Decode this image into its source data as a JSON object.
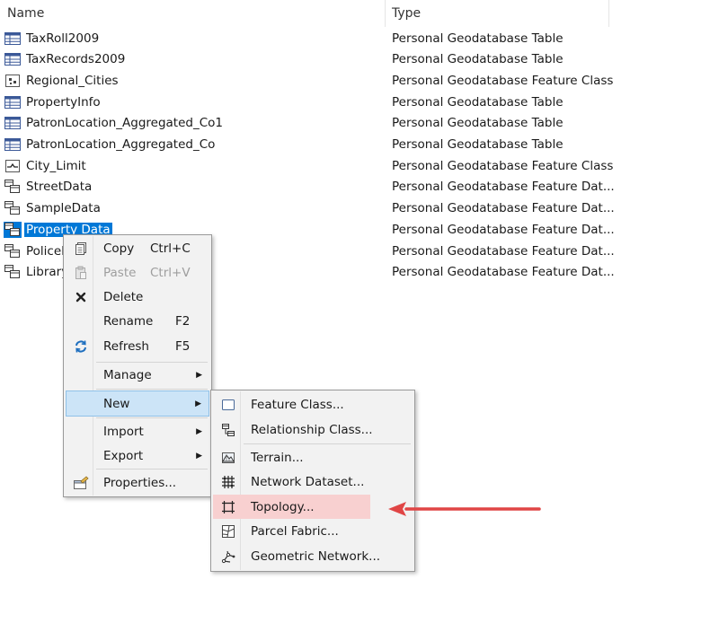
{
  "columns": {
    "name": "Name",
    "type": "Type"
  },
  "rows": [
    {
      "name": "TaxRoll2009",
      "type": "Personal Geodatabase Table",
      "icon": "table-icon"
    },
    {
      "name": "TaxRecords2009",
      "type": "Personal Geodatabase Table",
      "icon": "table-icon"
    },
    {
      "name": "Regional_Cities",
      "type": "Personal Geodatabase Feature Class",
      "icon": "point-feature-class-icon"
    },
    {
      "name": "PropertyInfo",
      "type": "Personal Geodatabase Table",
      "icon": "table-icon"
    },
    {
      "name": "PatronLocation_Aggregated_Co1",
      "type": "Personal Geodatabase Table",
      "icon": "table-icon"
    },
    {
      "name": "PatronLocation_Aggregated_Co",
      "type": "Personal Geodatabase Table",
      "icon": "table-icon"
    },
    {
      "name": "City_Limit",
      "type": "Personal Geodatabase Feature Class",
      "icon": "line-feature-class-icon"
    },
    {
      "name": "StreetData",
      "type": "Personal Geodatabase Feature Dat...",
      "icon": "feature-dataset-icon"
    },
    {
      "name": "SampleData",
      "type": "Personal Geodatabase Feature Dat...",
      "icon": "feature-dataset-icon"
    },
    {
      "name": "Property Data",
      "type": "Personal Geodatabase Feature Dat...",
      "icon": "feature-dataset-icon",
      "selected": true
    },
    {
      "name": "PoliceD",
      "type": "Personal Geodatabase Feature Dat...",
      "icon": "feature-dataset-icon"
    },
    {
      "name": "LibraryD",
      "type": "Personal Geodatabase Feature Dat...",
      "icon": "feature-dataset-icon"
    }
  ],
  "context_menu": {
    "copy": {
      "label": "Copy",
      "shortcut": "Ctrl+C",
      "icon": "copy-icon"
    },
    "paste": {
      "label": "Paste",
      "shortcut": "Ctrl+V",
      "icon": "paste-icon",
      "disabled": true
    },
    "delete": {
      "label": "Delete",
      "icon": "delete-x-icon"
    },
    "rename": {
      "label": "Rename",
      "shortcut": "F2"
    },
    "refresh": {
      "label": "Refresh",
      "shortcut": "F5",
      "icon": "refresh-icon"
    },
    "manage": {
      "label": "Manage"
    },
    "new": {
      "label": "New",
      "highlighted": true
    },
    "import": {
      "label": "Import"
    },
    "export": {
      "label": "Export"
    },
    "properties": {
      "label": "Properties...",
      "icon": "properties-icon"
    }
  },
  "submenu_new": {
    "feature_class": {
      "label": "Feature Class...",
      "icon": "feature-class-icon"
    },
    "relationship_class": {
      "label": "Relationship Class...",
      "icon": "relationship-class-icon"
    },
    "terrain": {
      "label": "Terrain...",
      "icon": "terrain-icon"
    },
    "network_dataset": {
      "label": "Network Dataset...",
      "icon": "network-dataset-icon"
    },
    "topology": {
      "label": "Topology...",
      "icon": "topology-icon",
      "highlighted": true
    },
    "parcel_fabric": {
      "label": "Parcel Fabric...",
      "icon": "parcel-fabric-icon"
    },
    "geometric_network": {
      "label": "Geometric Network...",
      "icon": "geometric-network-icon"
    }
  },
  "annotation": {
    "arrow_color": "#e04545",
    "highlight_color": "#f8d0d0",
    "selection_color": "#0078d7"
  }
}
